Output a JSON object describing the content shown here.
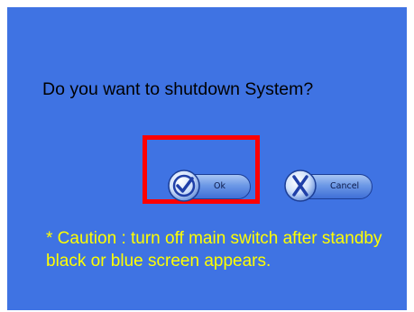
{
  "dialog": {
    "question": "Do you want to shutdown System?",
    "ok_label": "Ok",
    "ok_icon": "check-icon",
    "cancel_label": "Cancel",
    "cancel_icon": "x-icon",
    "caution_text": "* Caution : turn off main switch after standby black or blue screen appears."
  },
  "colors": {
    "background": "#3f73e3",
    "caution": "#ffff00",
    "highlight": "#ff0000"
  }
}
